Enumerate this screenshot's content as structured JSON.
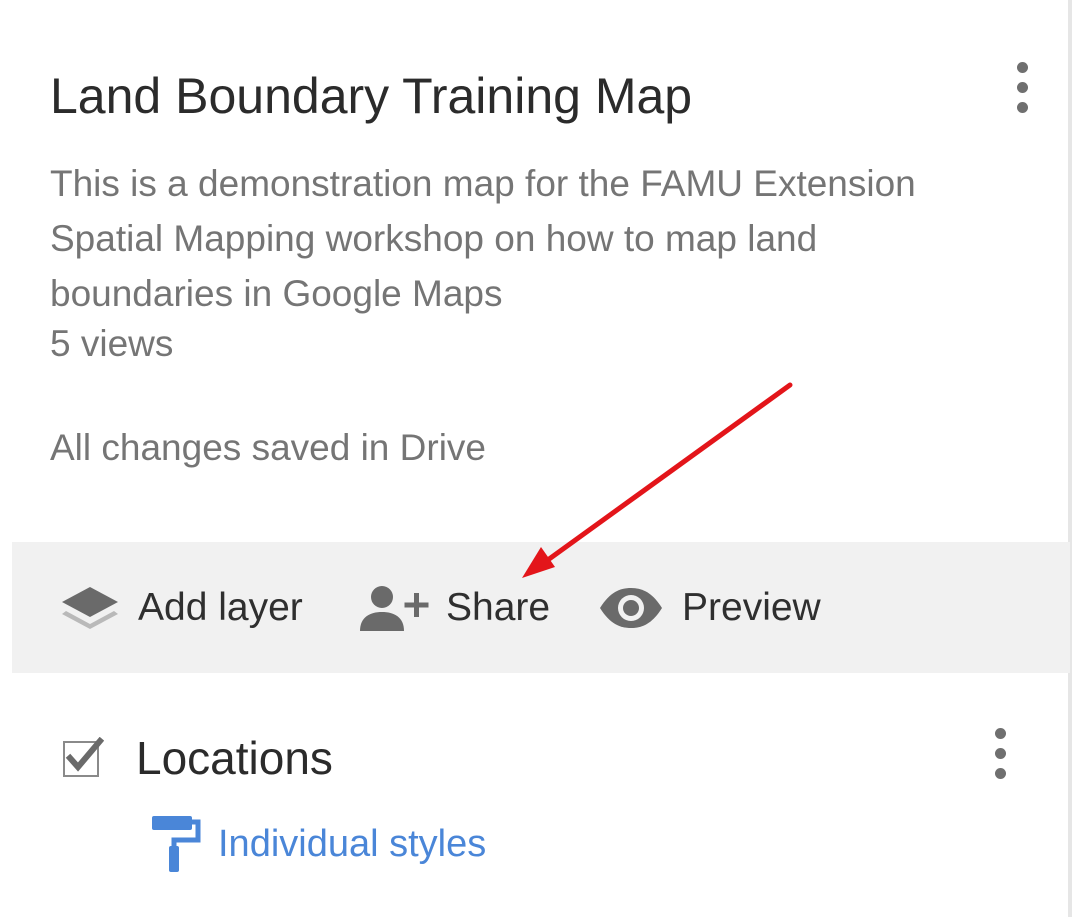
{
  "map": {
    "title": "Land Boundary Training Map",
    "description": "This is a demonstration map for the FAMU Extension Spatial Mapping workshop on how to map land boundaries in Google Maps",
    "views": "5 views",
    "save_status": "All changes saved in Drive"
  },
  "toolbar": {
    "add_layer": {
      "label": "Add layer",
      "icon": "layers-icon"
    },
    "share": {
      "label": "Share",
      "icon": "person-add-icon"
    },
    "preview": {
      "label": "Preview",
      "icon": "eye-icon"
    }
  },
  "layer": {
    "checked": true,
    "name": "Locations",
    "style_label": "Individual styles",
    "style_icon": "paint-roller-icon"
  },
  "colors": {
    "annotation_arrow": "#e3151a",
    "link_blue": "#4a86d8",
    "toolbar_bg": "#f1f1f1"
  }
}
